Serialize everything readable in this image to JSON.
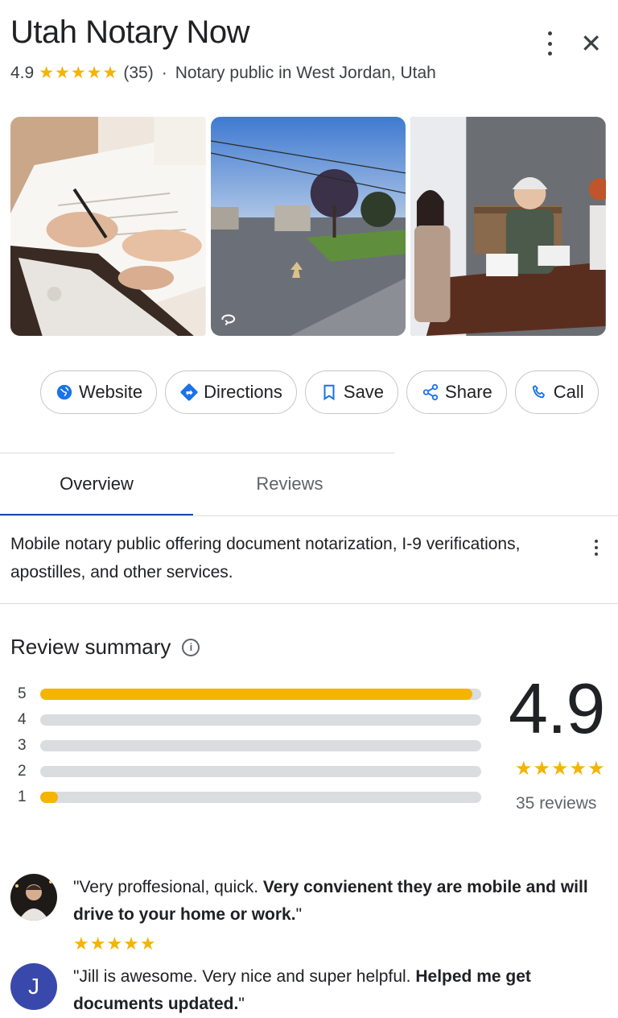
{
  "place": {
    "name": "Utah Notary Now",
    "rating": "4.9",
    "stars": "★★★★★",
    "review_count": "(35)",
    "separator": "·",
    "category": "Notary public in West Jordan, Utah"
  },
  "header_icons": [
    "more-vert-icon",
    "close-icon"
  ],
  "close_glyph": "✕",
  "photos": [
    "signing-documents",
    "street-view-office",
    "meeting-at-table"
  ],
  "actions": [
    {
      "label": "Website",
      "icon": "globe-icon"
    },
    {
      "label": "Directions",
      "icon": "directions-icon"
    },
    {
      "label": "Save",
      "icon": "bookmark-icon"
    },
    {
      "label": "Share",
      "icon": "share-icon"
    },
    {
      "label": "Call",
      "icon": "phone-icon"
    }
  ],
  "tabs": [
    {
      "label": "Overview",
      "active": true
    },
    {
      "label": "Reviews",
      "active": false
    }
  ],
  "description": "Mobile notary public offering document notarization, I-9 verifications, apostilles, and other services.",
  "review_summary": {
    "title": "Review summary",
    "info_glyph": "i",
    "rating": "4.9",
    "stars": "★★★★★",
    "count_label": "35 reviews",
    "distribution": [
      {
        "star": "5",
        "fraction": 0.98
      },
      {
        "star": "4",
        "fraction": 0.0
      },
      {
        "star": "3",
        "fraction": 0.0
      },
      {
        "star": "2",
        "fraction": 0.0
      },
      {
        "star": "1",
        "fraction": 0.04
      }
    ]
  },
  "reviews": [
    {
      "text_plain": "\"Very proffesional, quick. ",
      "text_bold": "Very convienent they are mobile and will drive to your home or work.",
      "text_end": "\"",
      "stars": "★★★★★"
    },
    {
      "avatar_letter": "J",
      "text_plain": "\"Jill is awesome. Very nice and super helpful. ",
      "text_bold": "Helped me get documents updated.",
      "text_end": "\""
    }
  ],
  "colors": {
    "accent": "#1a4aa8",
    "star": "#f4b400",
    "icon_blue": "#1a73e8"
  }
}
